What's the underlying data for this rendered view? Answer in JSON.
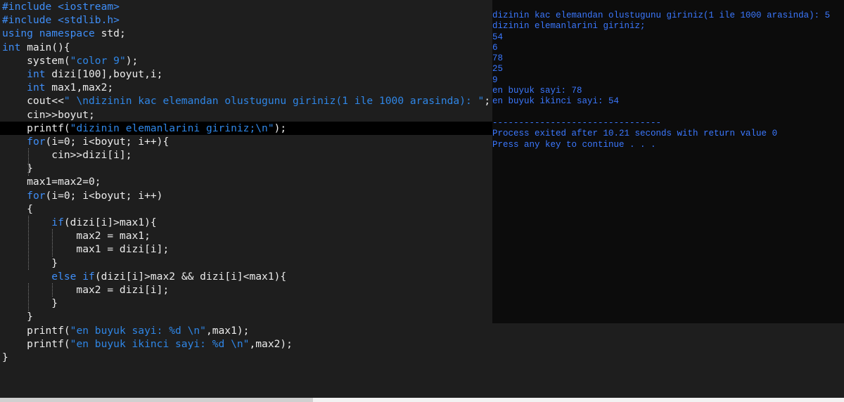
{
  "editor": {
    "lines": [
      {
        "segments": [
          {
            "cls": "pp",
            "text": "#include <iostream>"
          }
        ]
      },
      {
        "segments": [
          {
            "cls": "pp",
            "text": "#include <stdlib.h>"
          }
        ]
      },
      {
        "segments": [
          {
            "cls": "kw",
            "text": "using namespace"
          },
          {
            "cls": "plain",
            "text": " std;"
          }
        ]
      },
      {
        "segments": [
          {
            "cls": "kw",
            "text": "int"
          },
          {
            "cls": "plain",
            "text": " main(){"
          }
        ]
      },
      {
        "segments": [
          {
            "cls": "plain",
            "text": "    system("
          },
          {
            "cls": "str",
            "text": "\"color 9\""
          },
          {
            "cls": "plain",
            "text": ");"
          }
        ]
      },
      {
        "segments": [
          {
            "cls": "plain",
            "text": "    "
          },
          {
            "cls": "kw",
            "text": "int"
          },
          {
            "cls": "plain",
            "text": " dizi[100],boyut,i;"
          }
        ]
      },
      {
        "segments": [
          {
            "cls": "plain",
            "text": "    "
          },
          {
            "cls": "kw",
            "text": "int"
          },
          {
            "cls": "plain",
            "text": " max1,max2;"
          }
        ]
      },
      {
        "segments": [
          {
            "cls": "plain",
            "text": "    cout<<"
          },
          {
            "cls": "str",
            "text": "\" \\ndizinin kac elemandan olustugunu giriniz(1 ile 1000 arasinda): \""
          },
          {
            "cls": "plain",
            "text": ";"
          }
        ]
      },
      {
        "segments": [
          {
            "cls": "plain",
            "text": "    cin>>boyut;"
          }
        ]
      },
      {
        "current": true,
        "segments": [
          {
            "cls": "plain",
            "text": "    printf("
          },
          {
            "cls": "str",
            "text": "\"dizinin elemanlarini giriniz;\\n\""
          },
          {
            "cls": "plain",
            "text": ");"
          }
        ]
      },
      {
        "segments": [
          {
            "cls": "plain",
            "text": "    "
          },
          {
            "cls": "kw",
            "text": "for"
          },
          {
            "cls": "plain",
            "text": "(i=0; i<boyut; i++){"
          }
        ]
      },
      {
        "segments": [
          {
            "cls": "plain",
            "text": "        cin>>dizi[i];"
          }
        ]
      },
      {
        "segments": [
          {
            "cls": "plain",
            "text": "    }"
          }
        ]
      },
      {
        "segments": [
          {
            "cls": "plain",
            "text": "    max1=max2=0;"
          }
        ]
      },
      {
        "segments": [
          {
            "cls": "plain",
            "text": "    "
          },
          {
            "cls": "kw",
            "text": "for"
          },
          {
            "cls": "plain",
            "text": "(i=0; i<boyut; i++)"
          }
        ]
      },
      {
        "segments": [
          {
            "cls": "plain",
            "text": "    {"
          }
        ]
      },
      {
        "segments": [
          {
            "cls": "plain",
            "text": "        "
          },
          {
            "cls": "kw",
            "text": "if"
          },
          {
            "cls": "plain",
            "text": "(dizi[i]>max1){"
          }
        ]
      },
      {
        "segments": [
          {
            "cls": "plain",
            "text": "            max2 = max1;"
          }
        ]
      },
      {
        "segments": [
          {
            "cls": "plain",
            "text": "            max1 = dizi[i];"
          }
        ]
      },
      {
        "segments": [
          {
            "cls": "plain",
            "text": "        }"
          }
        ]
      },
      {
        "segments": [
          {
            "cls": "plain",
            "text": "        "
          },
          {
            "cls": "kw",
            "text": "else if"
          },
          {
            "cls": "plain",
            "text": "(dizi[i]>max2 && dizi[i]<max1){"
          }
        ]
      },
      {
        "segments": [
          {
            "cls": "plain",
            "text": "            max2 = dizi[i];"
          }
        ]
      },
      {
        "segments": [
          {
            "cls": "plain",
            "text": "        }"
          }
        ]
      },
      {
        "segments": [
          {
            "cls": "plain",
            "text": "    }"
          }
        ]
      },
      {
        "segments": [
          {
            "cls": "plain",
            "text": "    printf("
          },
          {
            "cls": "str",
            "text": "\"en buyuk sayi: %d \\n\""
          },
          {
            "cls": "plain",
            "text": ",max1);"
          }
        ]
      },
      {
        "segments": [
          {
            "cls": "plain",
            "text": "    printf("
          },
          {
            "cls": "str",
            "text": "\"en buyuk ikinci sayi: %d \\n\""
          },
          {
            "cls": "plain",
            "text": ",max2);"
          }
        ]
      },
      {
        "segments": [
          {
            "cls": "plain",
            "text": "}"
          }
        ]
      }
    ]
  },
  "console": {
    "lines": [
      "dizinin kac elemandan olustugunu giriniz(1 ile 1000 arasinda): 5",
      "dizinin elemanlarini giriniz;",
      "54",
      "6",
      "78",
      "25",
      "9",
      "en buyuk sayi: 78",
      "en buyuk ikinci sayi: 54",
      "",
      "--------------------------------",
      "Process exited after 10.21 seconds with return value 0",
      "Press any key to continue . . ."
    ]
  },
  "colors": {
    "editor_background": "#1e1e1e",
    "console_background": "#0c0c0c",
    "keyword": "#3f8ef7",
    "string": "#2f86e6",
    "console_text": "#3b78ff"
  }
}
